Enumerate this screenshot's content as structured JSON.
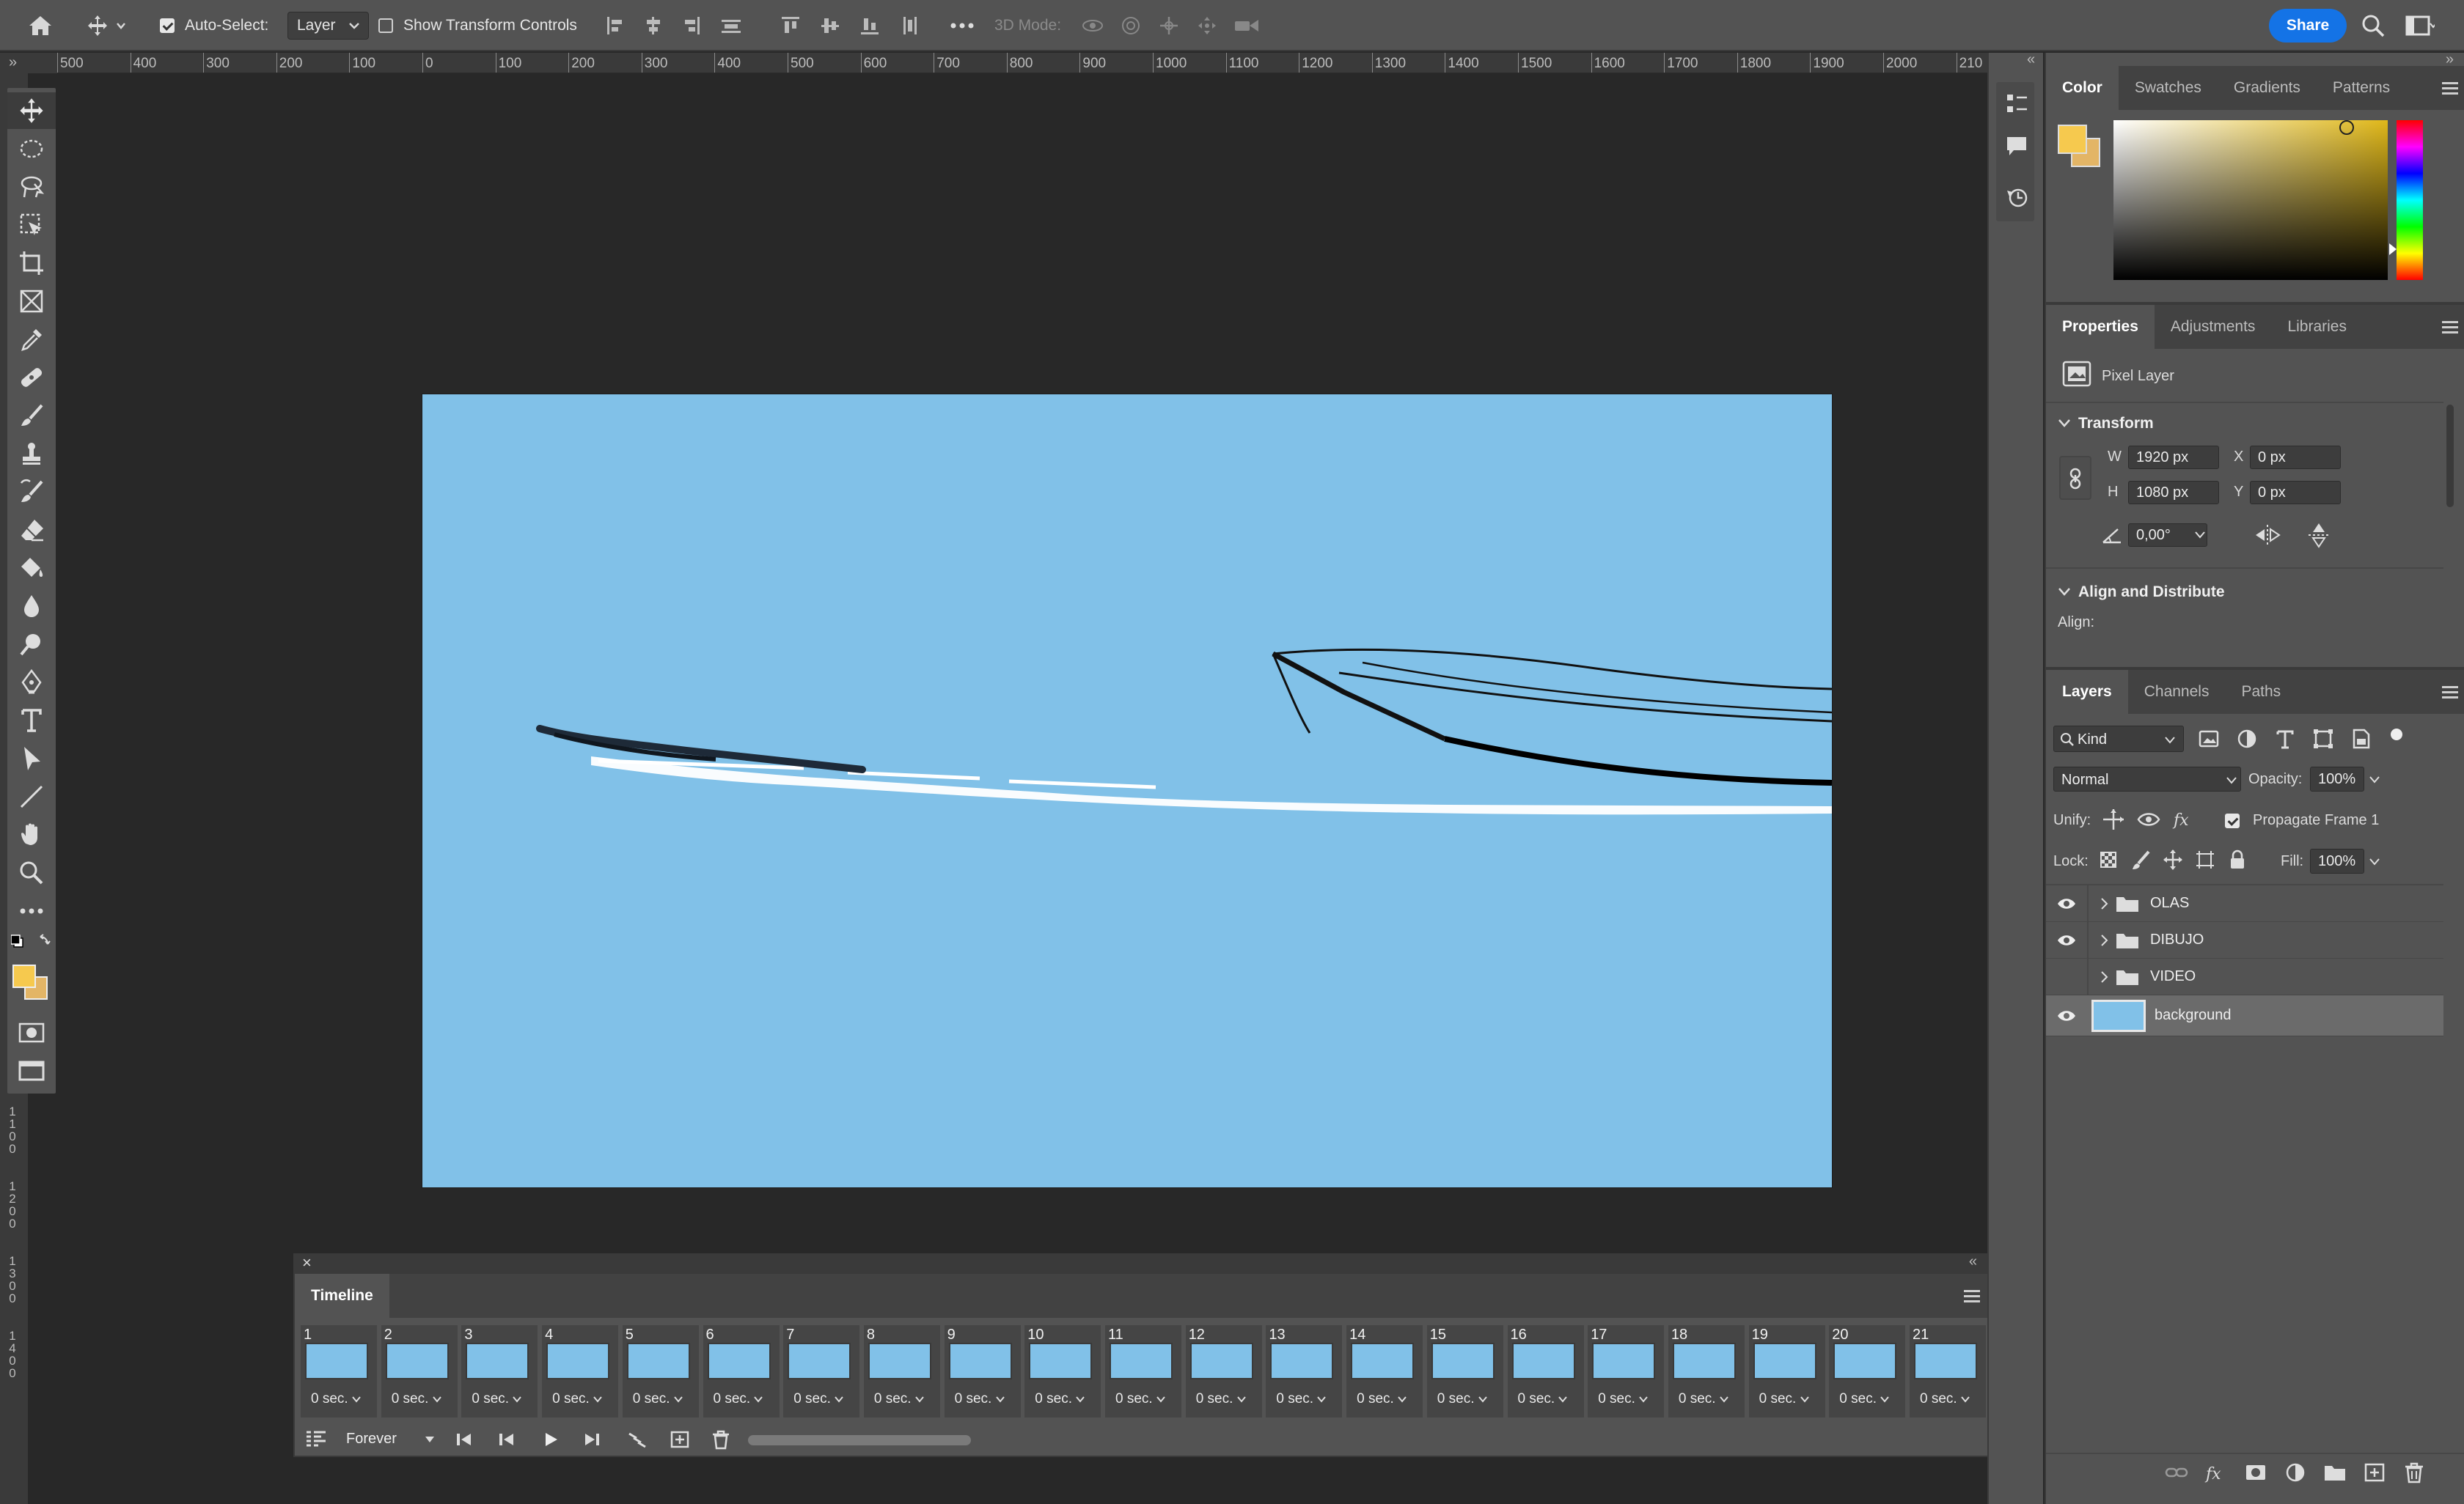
{
  "options_bar": {
    "auto_select_label": "Auto-Select:",
    "auto_select_value": "Layer",
    "show_transform_label": "Show Transform Controls",
    "mode_3d_label": "3D Mode:",
    "share_label": "Share"
  },
  "ruler": {
    "h_ticks": [
      "500",
      "400",
      "300",
      "200",
      "100",
      "0",
      "100",
      "200",
      "300",
      "400",
      "500",
      "600",
      "700",
      "800",
      "900",
      "1000",
      "1100",
      "1200",
      "1300",
      "1400",
      "1500",
      "1600",
      "1700",
      "1800",
      "1900",
      "2000",
      "210"
    ],
    "v_ticks": [
      "1\n0\n0\n0",
      "1\n1\n0\n0",
      "1\n2\n0\n0",
      "1\n3\n0\n0",
      "1\n4\n0\n0"
    ]
  },
  "color_panel": {
    "tabs": [
      "Color",
      "Swatches",
      "Gradients",
      "Patterns"
    ],
    "foreground": "#f6c94e",
    "background": "#e3b566"
  },
  "properties_panel": {
    "tabs": [
      "Properties",
      "Adjustments",
      "Libraries"
    ],
    "layer_type": "Pixel Layer",
    "transform_title": "Transform",
    "w_label": "W",
    "w_value": "1920 px",
    "h_label": "H",
    "h_value": "1080 px",
    "x_label": "X",
    "x_value": "0 px",
    "y_label": "Y",
    "y_value": "0 px",
    "angle_value": "0,00°",
    "align_title": "Align and Distribute",
    "align_label": "Align:"
  },
  "layers_panel": {
    "tabs": [
      "Layers",
      "Channels",
      "Paths"
    ],
    "kind_label": "Kind",
    "blend_mode": "Normal",
    "opacity_label": "Opacity:",
    "opacity_value": "100%",
    "unify_label": "Unify:",
    "propagate_label": "Propagate Frame 1",
    "lock_label": "Lock:",
    "fill_label": "Fill:",
    "fill_value": "100%",
    "layers": [
      {
        "name": "OLAS",
        "visible": true,
        "type": "group"
      },
      {
        "name": "DIBUJO",
        "visible": true,
        "type": "group"
      },
      {
        "name": "VIDEO",
        "visible": false,
        "type": "group"
      },
      {
        "name": "background",
        "visible": true,
        "type": "pixel",
        "selected": true
      }
    ]
  },
  "timeline": {
    "title": "Timeline",
    "loop_value": "Forever",
    "frames": [
      {
        "num": "1",
        "dur": "0 sec."
      },
      {
        "num": "2",
        "dur": "0 sec."
      },
      {
        "num": "3",
        "dur": "0 sec."
      },
      {
        "num": "4",
        "dur": "0 sec."
      },
      {
        "num": "5",
        "dur": "0 sec."
      },
      {
        "num": "6",
        "dur": "0 sec."
      },
      {
        "num": "7",
        "dur": "0 sec."
      },
      {
        "num": "8",
        "dur": "0 sec."
      },
      {
        "num": "9",
        "dur": "0 sec."
      },
      {
        "num": "10",
        "dur": "0 sec."
      },
      {
        "num": "11",
        "dur": "0 sec."
      },
      {
        "num": "12",
        "dur": "0 sec."
      },
      {
        "num": "13",
        "dur": "0 sec."
      },
      {
        "num": "14",
        "dur": "0 sec."
      },
      {
        "num": "15",
        "dur": "0 sec."
      },
      {
        "num": "16",
        "dur": "0 sec."
      },
      {
        "num": "17",
        "dur": "0 sec."
      },
      {
        "num": "18",
        "dur": "0 sec."
      },
      {
        "num": "19",
        "dur": "0 sec."
      },
      {
        "num": "20",
        "dur": "0 sec."
      },
      {
        "num": "21",
        "dur": "0 sec."
      }
    ]
  },
  "canvas": {
    "color": "#81c1e8"
  }
}
